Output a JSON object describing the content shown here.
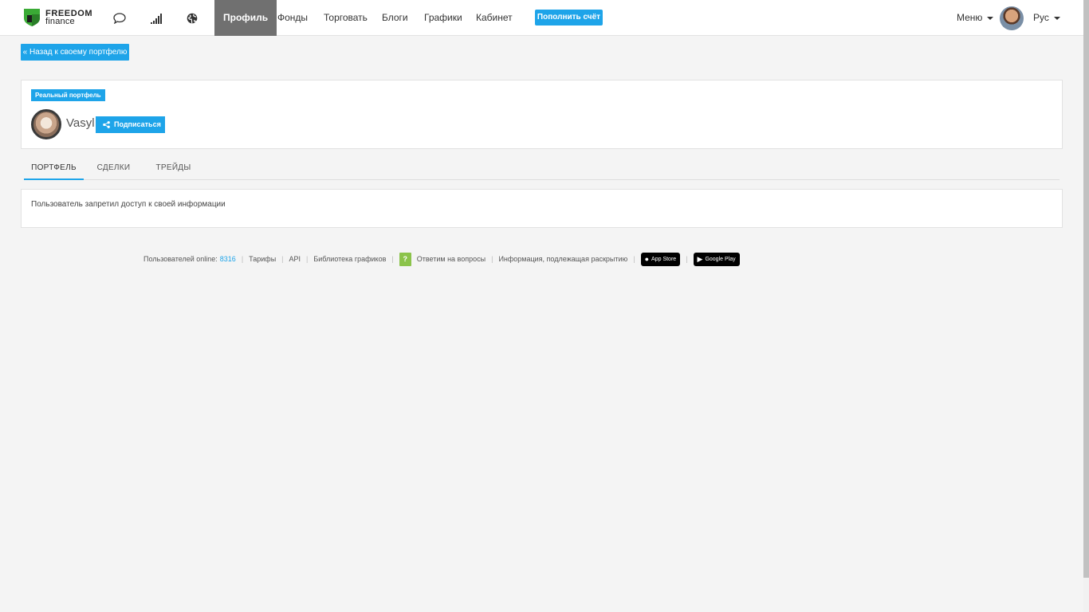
{
  "header": {
    "logo_line1": "FREEDOM",
    "logo_line2": "finance",
    "nav": [
      "Профиль",
      "Фонды",
      "Торговать",
      "Блоги",
      "Графики",
      "Кабинет"
    ],
    "topup_label": "Пополнить счёт",
    "menu_label": "Меню",
    "lang_label": "Рус",
    "icons": [
      "chat-icon",
      "signal-bars-icon",
      "globe-icon"
    ]
  },
  "back_button": "« Назад к своему портфелю",
  "profile": {
    "badge": "Реальный портфель",
    "username": "Vasyl",
    "subscribe_label": "Подписаться"
  },
  "tabs": [
    "ПОРТФЕЛЬ",
    "СДЕЛКИ",
    "ТРЕЙДЫ"
  ],
  "message": "Пользователь запретил доступ к своей информации",
  "footer": {
    "online_label": "Пользователей online:",
    "online_count": "8316",
    "links": [
      "Тарифы",
      "API",
      "Библиотека графиков"
    ],
    "faq_icon": "?",
    "faq_label": "Ответим на вопросы",
    "disclosure_label": "Информация, подлежащая раскрытию",
    "app_store": "App Store",
    "google_play": "Google Play"
  },
  "colors": {
    "accent": "#1ea4e9",
    "nav_active_bg": "#707070",
    "logo_green": "#3aaa35"
  }
}
